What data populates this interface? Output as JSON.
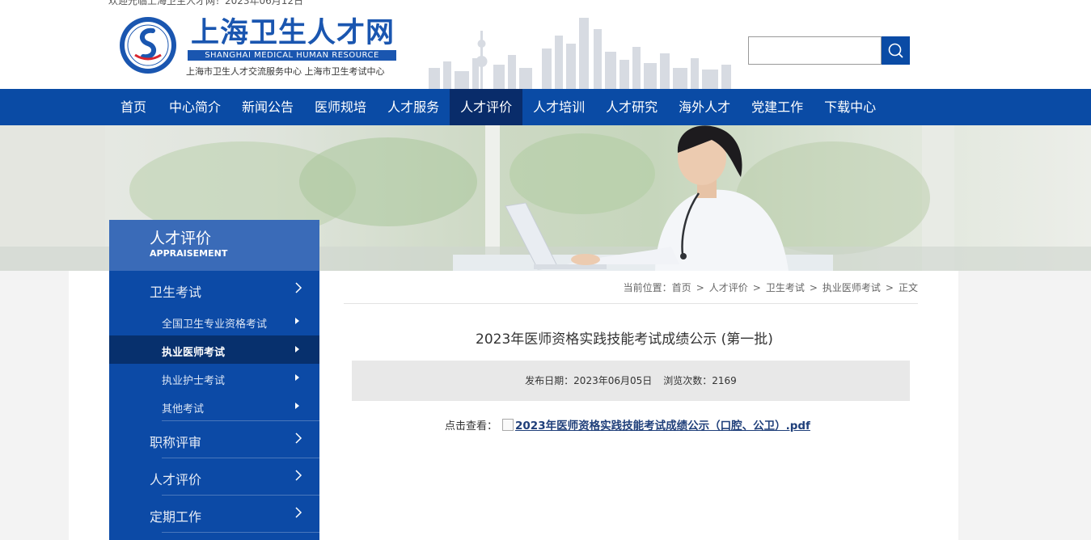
{
  "header": {
    "welcome": "欢迎光临上海卫生人才网！2023年06月12日",
    "logo_title": "上海卫生人才网",
    "logo_subtitle_en": "SHANGHAI MEDICAL HUMAN RESOURCE",
    "logo_org": "上海市卫生人才交流服务中心  上海市卫生考试中心",
    "search_value": "",
    "search_icon": "search-icon"
  },
  "nav": {
    "items": [
      {
        "label": "首页"
      },
      {
        "label": "中心简介"
      },
      {
        "label": "新闻公告"
      },
      {
        "label": "医师规培"
      },
      {
        "label": "人才服务"
      },
      {
        "label": "人才评价"
      },
      {
        "label": "人才培训"
      },
      {
        "label": "人才研究"
      },
      {
        "label": "海外人才"
      },
      {
        "label": "党建工作"
      },
      {
        "label": "下载中心"
      }
    ],
    "active": "人才评价"
  },
  "sidebar": {
    "title": "人才评价",
    "title_en": "APPRAISEMENT",
    "categories": [
      {
        "label": "卫生考试"
      },
      {
        "label": "职称评审"
      },
      {
        "label": "人才评价"
      },
      {
        "label": "定期工作"
      }
    ],
    "subitems": [
      {
        "label": "全国卫生专业资格考试"
      },
      {
        "label": "执业医师考试"
      },
      {
        "label": "执业护士考试"
      },
      {
        "label": "其他考试"
      }
    ],
    "active_subitem": "执业医师考试"
  },
  "breadcrumb": {
    "prefix": "当前位置：",
    "items": [
      "首页",
      "人才评价",
      "卫生考试",
      "执业医师考试",
      "正文"
    ],
    "separator": ">"
  },
  "article": {
    "title": "2023年医师资格实践技能考试成绩公示 (第一批)",
    "publish_label": "发布日期：",
    "publish_date": "2023年06月05日",
    "views_label": "浏览次数：",
    "views": "2169",
    "attachment_label": "点击查看：",
    "attachment_name": "2023年医师资格实践技能考试成绩公示（口腔、公卫）.pdf"
  },
  "colors": {
    "brand_blue": "#0a4ba5",
    "nav_active": "#092c6a",
    "sidebar_bg": "#0c4aa6",
    "sidebar_head": "#3a6bb8"
  }
}
